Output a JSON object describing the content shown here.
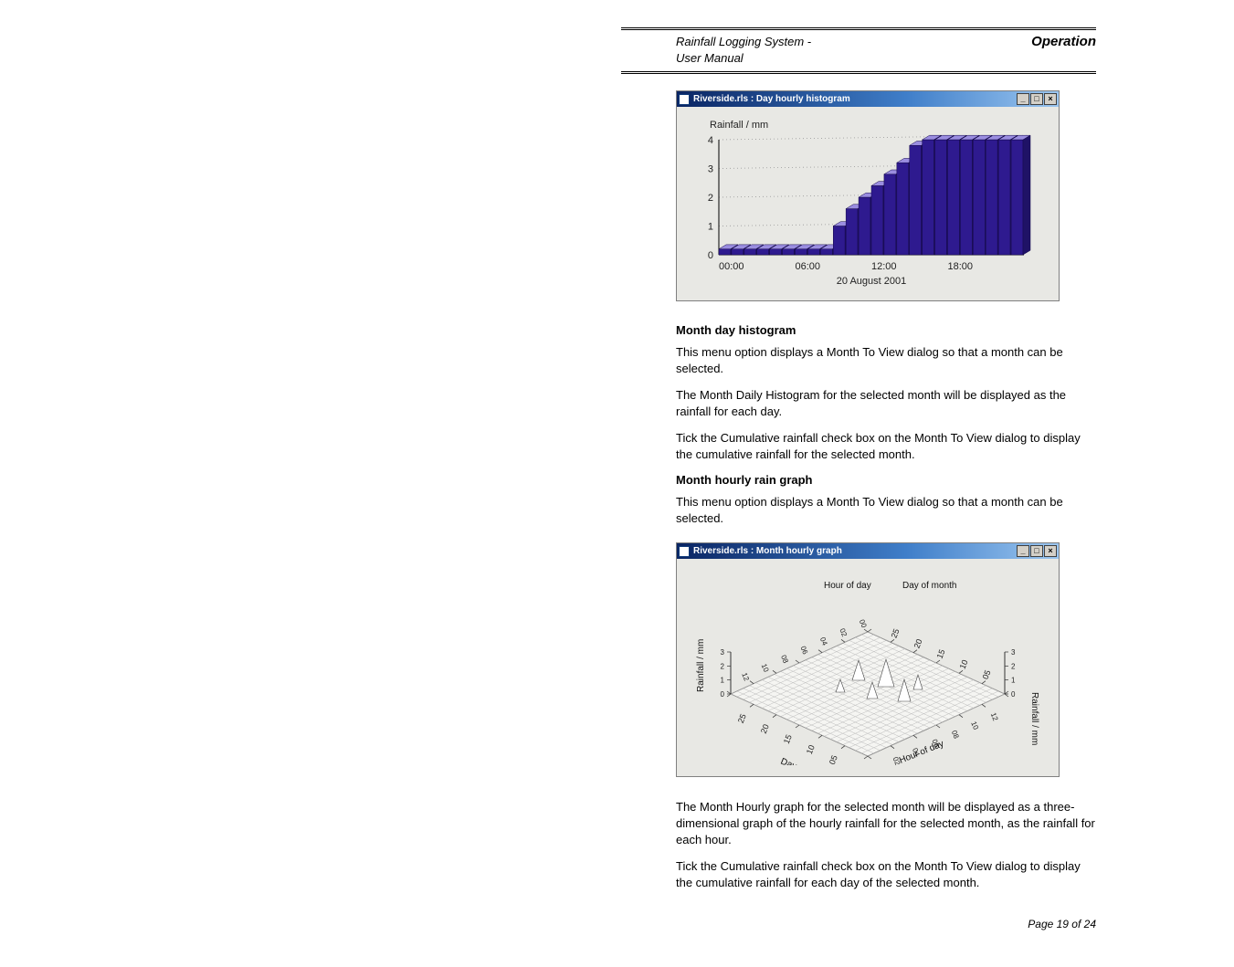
{
  "header": {
    "left_line1": "Rainfall Logging System -",
    "left_line2": "User Manual",
    "right": "Operation"
  },
  "figure1": {
    "window_title": "Riverside.rls : Day hourly histogram",
    "ylabel": "Rainfall / mm",
    "xlabel": "20 August 2001"
  },
  "section1": {
    "heading": "Month day histogram",
    "p1": "This menu option displays a Month To View dialog so that a month can be selected.",
    "p2": "The Month Daily Histogram for the selected month will be displayed as the rainfall for each day.",
    "p3": "Tick the Cumulative rainfall check box on the Month To View dialog to display the cumulative rainfall for the selected month."
  },
  "section2": {
    "heading": "Month hourly rain graph",
    "p1": "This menu option displays a Month To View dialog so that a month can be selected.",
    "p2": "The Month Hourly graph for the selected month will be displayed as a three-dimensional graph of the hourly rainfall for the selected month, as the rainfall for each hour.",
    "p3": "Tick the Cumulative rainfall check box on the Month To View dialog to display the cumulative rainfall for each day of the selected month."
  },
  "figure2": {
    "window_title": "Riverside.rls : Month hourly graph",
    "axis_hour": "Hour of day",
    "axis_day": "Day of month",
    "axis_rain_l": "Rainfall / mm",
    "axis_rain_r": "Rainfall / mm"
  },
  "footer": {
    "text": "Page 19 of 24"
  },
  "chart_data": {
    "type": "bar",
    "title": "Riverside.rls : Day hourly histogram",
    "xlabel": "20 August 2001",
    "ylabel": "Rainfall / mm",
    "ylim": [
      0,
      4
    ],
    "categories": [
      "00:00",
      "01:00",
      "02:00",
      "03:00",
      "04:00",
      "05:00",
      "06:00",
      "07:00",
      "08:00",
      "09:00",
      "10:00",
      "11:00",
      "12:00",
      "13:00",
      "14:00",
      "15:00",
      "16:00",
      "17:00",
      "18:00",
      "19:00",
      "20:00",
      "21:00",
      "22:00",
      "23:00"
    ],
    "xticks": [
      "00:00",
      "06:00",
      "12:00",
      "18:00"
    ],
    "yticks": [
      0,
      1,
      2,
      3,
      4
    ],
    "values": [
      0.2,
      0.2,
      0.2,
      0.2,
      0.2,
      0.2,
      0.2,
      0.2,
      0.2,
      1.0,
      1.6,
      2.0,
      2.4,
      2.8,
      3.2,
      3.8,
      4.0,
      4.0,
      4.0,
      4.0,
      4.0,
      4.0,
      4.0,
      4.0
    ]
  }
}
